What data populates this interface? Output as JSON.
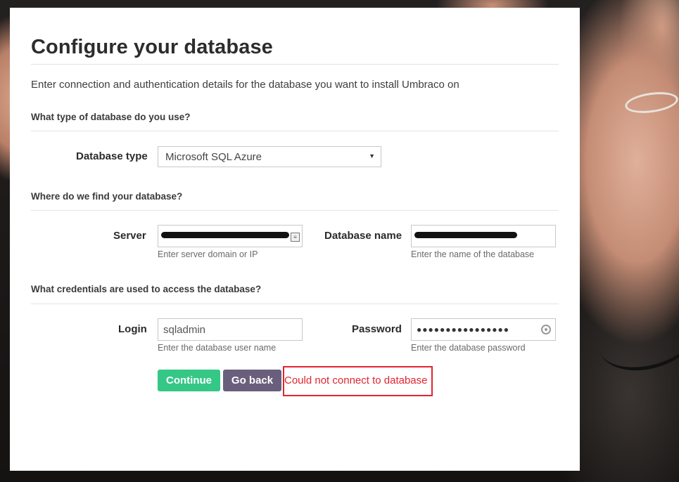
{
  "page": {
    "title": "Configure your database",
    "intro": "Enter connection and authentication details for the database you want to install Umbraco on"
  },
  "sections": {
    "db_type": "What type of database do you use?",
    "location": "Where do we find your database?",
    "credentials": "What credentials are used to access the database?"
  },
  "database_type": {
    "label": "Database type",
    "selected": "Microsoft SQL Azure"
  },
  "server": {
    "label": "Server",
    "hint": "Enter server domain or IP"
  },
  "database_name": {
    "label": "Database name",
    "hint": "Enter the name of the database"
  },
  "login": {
    "label": "Login",
    "value": "sqladmin",
    "hint": "Enter the database user name"
  },
  "password": {
    "label": "Password",
    "masked_value": "●●●●●●●●●●●●●●●●",
    "hint": "Enter the database password"
  },
  "buttons": {
    "continue": "Continue",
    "go_back": "Go back"
  },
  "error": {
    "message": "Could not connect to database"
  },
  "colors": {
    "continue_button": "#35c786",
    "go_back_button": "#695f7d",
    "error": "#e0262f"
  }
}
